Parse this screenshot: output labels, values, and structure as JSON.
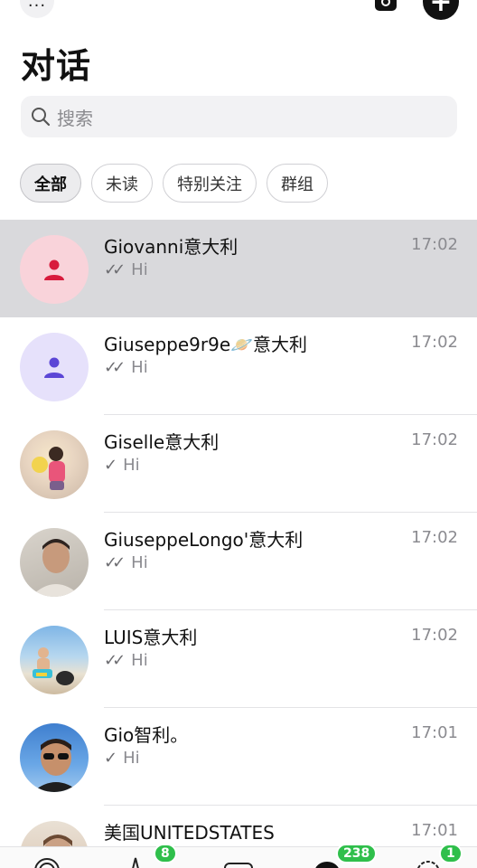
{
  "header": {
    "menu_icon": "ellipsis-icon",
    "menu_label": "···",
    "camera_icon": "camera-icon",
    "compose_icon": "plus-icon",
    "compose_label": "+",
    "title": "对话"
  },
  "search": {
    "placeholder": "搜索",
    "icon": "search-icon"
  },
  "filters": [
    {
      "label": "全部",
      "active": true
    },
    {
      "label": "未读",
      "active": false
    },
    {
      "label": "特别关注",
      "active": false
    },
    {
      "label": "群组",
      "active": false
    }
  ],
  "chats": [
    {
      "name": "Giovanni意大利",
      "preview": "Hi",
      "time": "17:02",
      "ticks": "✓✓",
      "avatar": "person-icon",
      "avatar_color": "#f9d3da",
      "icon_color": "#d81b3c",
      "selected": true
    },
    {
      "name": "Giuseppe9r9e🪐意大利",
      "preview": "Hi",
      "time": "17:02",
      "ticks": "✓✓",
      "avatar": "person-icon",
      "avatar_color": "#e6e1fb",
      "icon_color": "#5b46d6",
      "selected": false
    },
    {
      "name": "Giselle意大利",
      "preview": "Hi",
      "time": "17:02",
      "ticks": "✓",
      "avatar": "photo-avatar",
      "selected": false
    },
    {
      "name": "GiuseppeLongo'意大利",
      "preview": "Hi",
      "time": "17:02",
      "ticks": "✓✓",
      "avatar": "photo-avatar",
      "selected": false
    },
    {
      "name": "LUIS意大利",
      "preview": "Hi",
      "time": "17:02",
      "ticks": "✓✓",
      "avatar": "photo-avatar",
      "selected": false
    },
    {
      "name": "Gio智利。",
      "preview": "Hi",
      "time": "17:01",
      "ticks": "✓",
      "avatar": "photo-avatar",
      "selected": false
    },
    {
      "name": "美国UNITEDSTATES",
      "preview": "",
      "time": "17:01",
      "ticks": "",
      "avatar": "photo-avatar",
      "selected": false
    }
  ],
  "tabbar": {
    "tabs": [
      {
        "icon": "status-icon",
        "badge": ""
      },
      {
        "icon": "calls-icon",
        "badge": "8"
      },
      {
        "icon": "communities-icon",
        "badge": ""
      },
      {
        "icon": "chats-icon",
        "badge": "238"
      },
      {
        "icon": "settings-icon",
        "badge": "1"
      }
    ]
  },
  "colors": {
    "badge": "#2fbf4b",
    "selected_row": "#d9d9dc"
  }
}
